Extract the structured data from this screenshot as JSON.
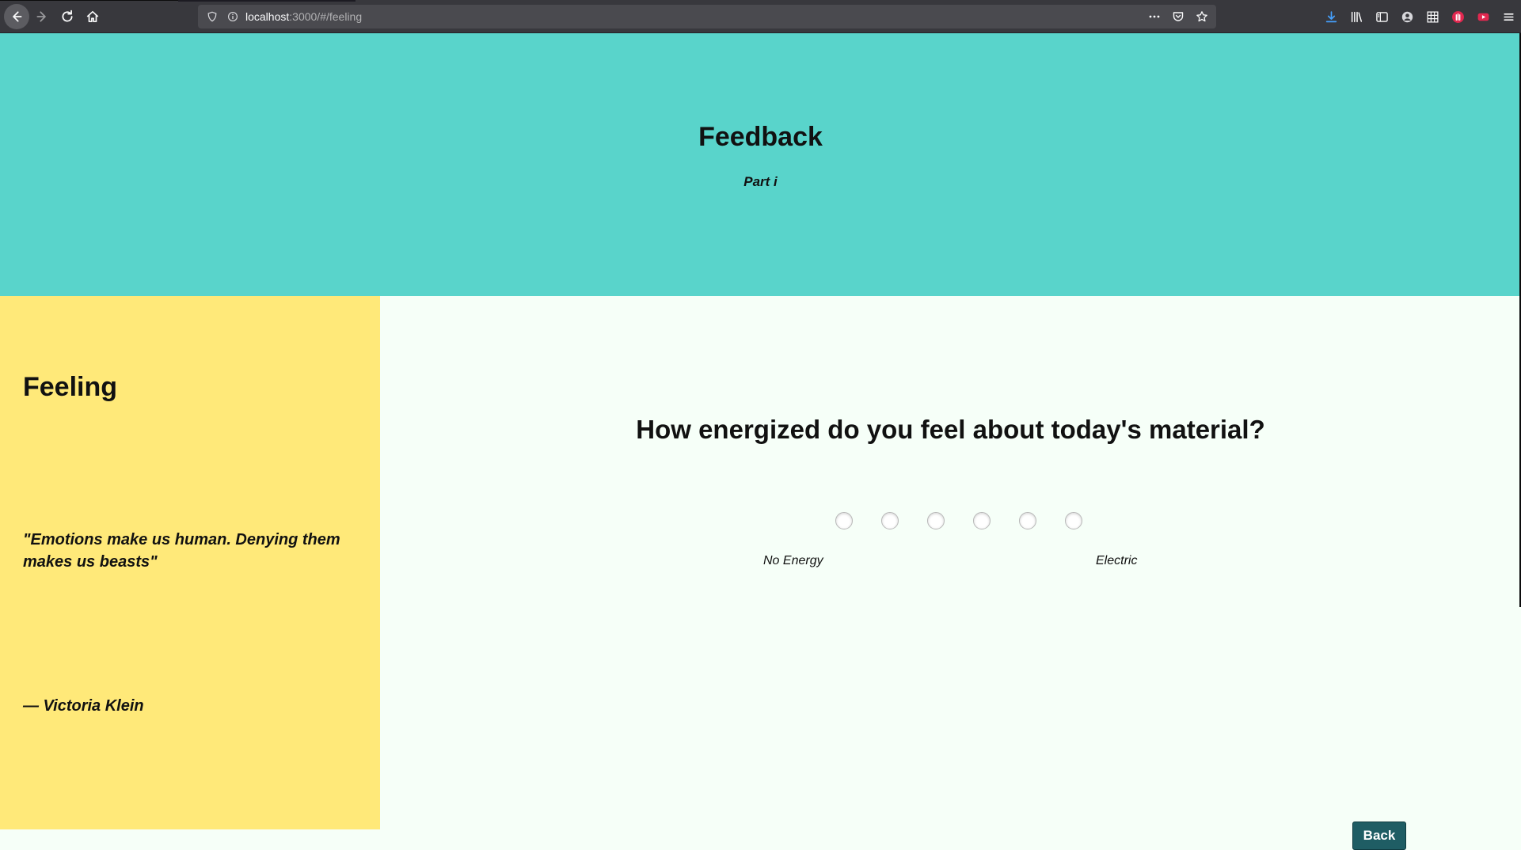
{
  "browser": {
    "url_host": "localhost",
    "url_rest": ":3000/#/feeling"
  },
  "hero": {
    "title": "Feedback",
    "subtitle": "Part i"
  },
  "sidebar": {
    "title": "Feeling",
    "quote": "\"Emotions make us human. Denying them makes us beasts\"",
    "author": "— Victoria Klein"
  },
  "main": {
    "question": "How energized do you feel about today's material?",
    "scale": {
      "options_count": 6,
      "low_label": "No Energy",
      "high_label": "Electric"
    },
    "back_label": "Back"
  },
  "colors": {
    "hero_bg": "#59d4cb",
    "sidebar_bg": "#ffe979",
    "main_bg": "#f6fff8",
    "button_bg": "#1f5d64"
  }
}
